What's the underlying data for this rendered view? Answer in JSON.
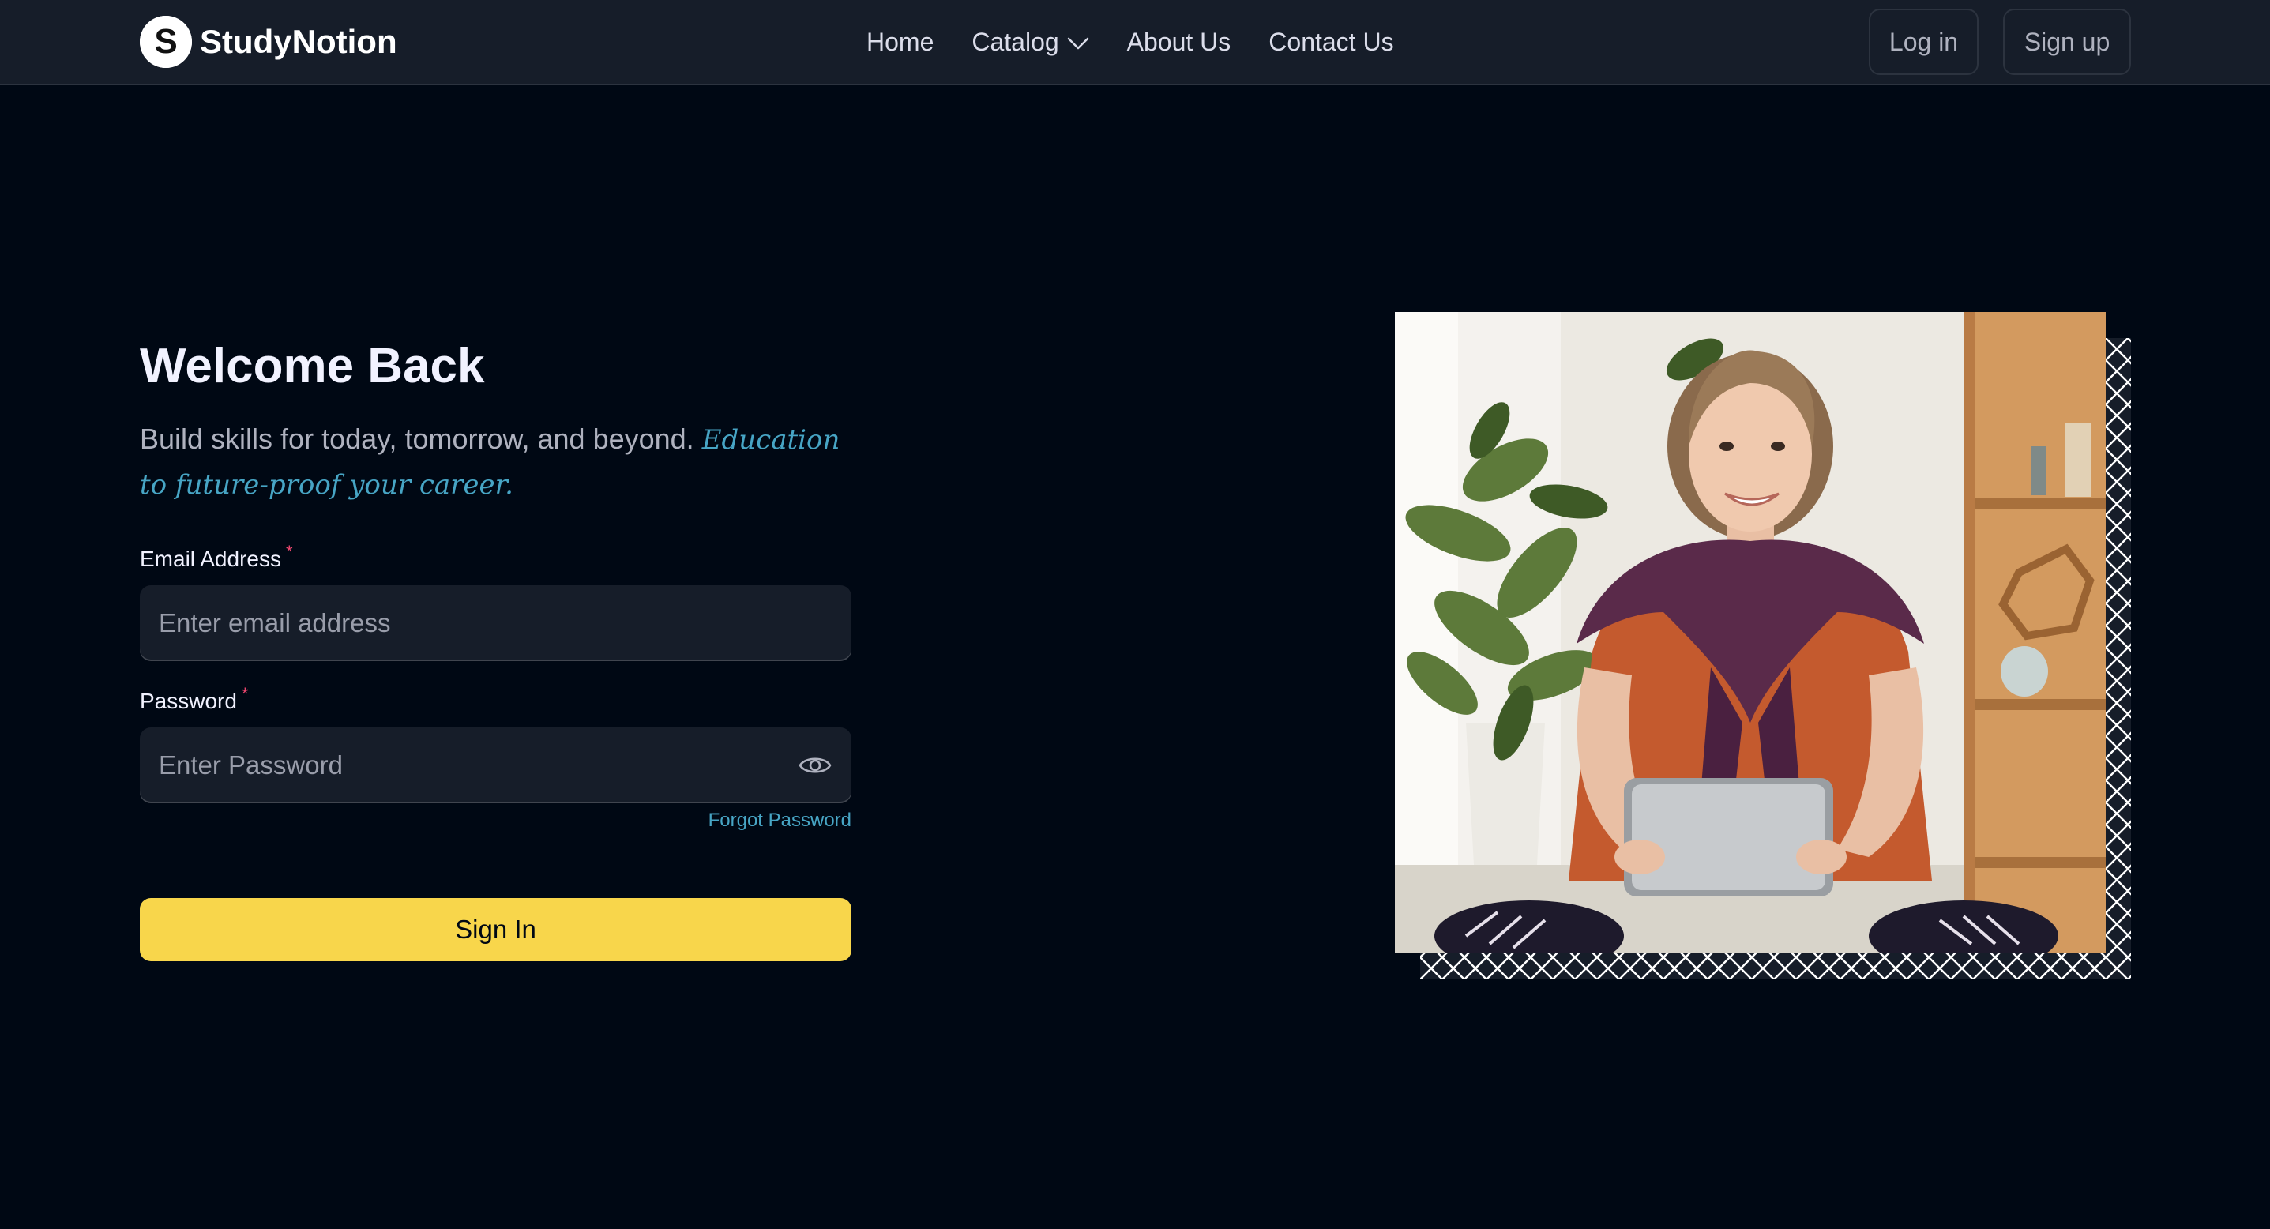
{
  "brand": {
    "name": "StudyNotion",
    "logo_letter": "S"
  },
  "nav": {
    "links": [
      "Home",
      "Catalog",
      "About Us",
      "Contact Us"
    ],
    "login_label": "Log in",
    "signup_label": "Sign up"
  },
  "login": {
    "title": "Welcome Back",
    "subtitle": "Build skills for today, tomorrow, and beyond.",
    "subtitle_accent": "Education to future-proof your career.",
    "email_label": "Email Address",
    "email_placeholder": "Enter email address",
    "password_label": "Password",
    "password_placeholder": "Enter Password",
    "required_mark": "*",
    "forgot_label": "Forgot Password",
    "submit_label": "Sign In"
  },
  "hero": {
    "image_alt": "Smiling girl holding a tablet"
  },
  "colors": {
    "background": "#000814",
    "navbar": "#161d29",
    "accent_yellow": "#f8d64b",
    "accent_blue": "#47a5c5",
    "required_pink": "#ef476f"
  },
  "icons": [
    "logo-icon",
    "chevron-down-icon",
    "eye-icon",
    "frame-pattern"
  ]
}
